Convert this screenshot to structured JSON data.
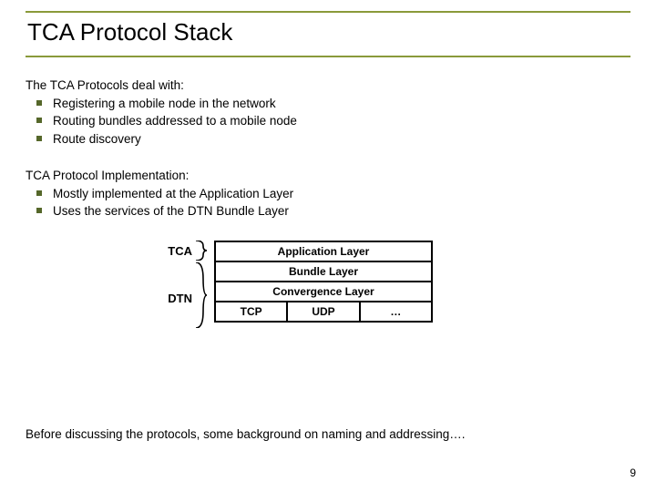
{
  "title": "TCA Protocol Stack",
  "section1": {
    "lead": "The TCA Protocols deal with:",
    "bullets": [
      "Registering a mobile node in the network",
      "Routing bundles addressed to a mobile node",
      "Route discovery"
    ]
  },
  "section2": {
    "lead": "TCA Protocol Implementation:",
    "bullets": [
      "Mostly implemented at the Application Layer",
      "Uses the services of the DTN Bundle Layer"
    ]
  },
  "stack": {
    "label_tca": "TCA",
    "label_dtn": "DTN",
    "layers": {
      "app": "Application Layer",
      "bundle": "Bundle Layer",
      "conv": "Convergence Layer",
      "sub": [
        "TCP",
        "UDP",
        "…"
      ]
    }
  },
  "bottom_note": "Before discussing the protocols, some background on naming and addressing….",
  "page_number": "9"
}
